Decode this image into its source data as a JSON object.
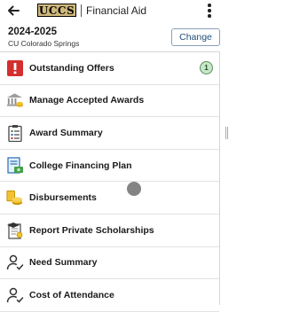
{
  "header": {
    "logo_text": "UCCS",
    "title": "Financial Aid",
    "back_icon": "back-arrow-icon",
    "menu_icon": "more-vertical-icon"
  },
  "context": {
    "aid_year": "2024-2025",
    "institution": "CU Colorado Springs",
    "change_label": "Change"
  },
  "menu": {
    "items": [
      {
        "label": "Outstanding Offers",
        "icon": "alert-icon",
        "badge": "1"
      },
      {
        "label": "Manage Accepted Awards",
        "icon": "bank-icon"
      },
      {
        "label": "Award Summary",
        "icon": "clipboard-icon"
      },
      {
        "label": "College Financing Plan",
        "icon": "financing-plan-icon"
      },
      {
        "label": "Disbursements",
        "icon": "coins-icon"
      },
      {
        "label": "Report Private Scholarships",
        "icon": "scholarship-report-icon"
      },
      {
        "label": "Need Summary",
        "icon": "person-check-icon"
      },
      {
        "label": "Cost of Attendance",
        "icon": "person-check-icon"
      }
    ]
  },
  "colors": {
    "logo_gold": "#cfb87c",
    "alert_red": "#d32f2f",
    "badge_green": "#c8e6c9",
    "button_text": "#1f4e79"
  }
}
